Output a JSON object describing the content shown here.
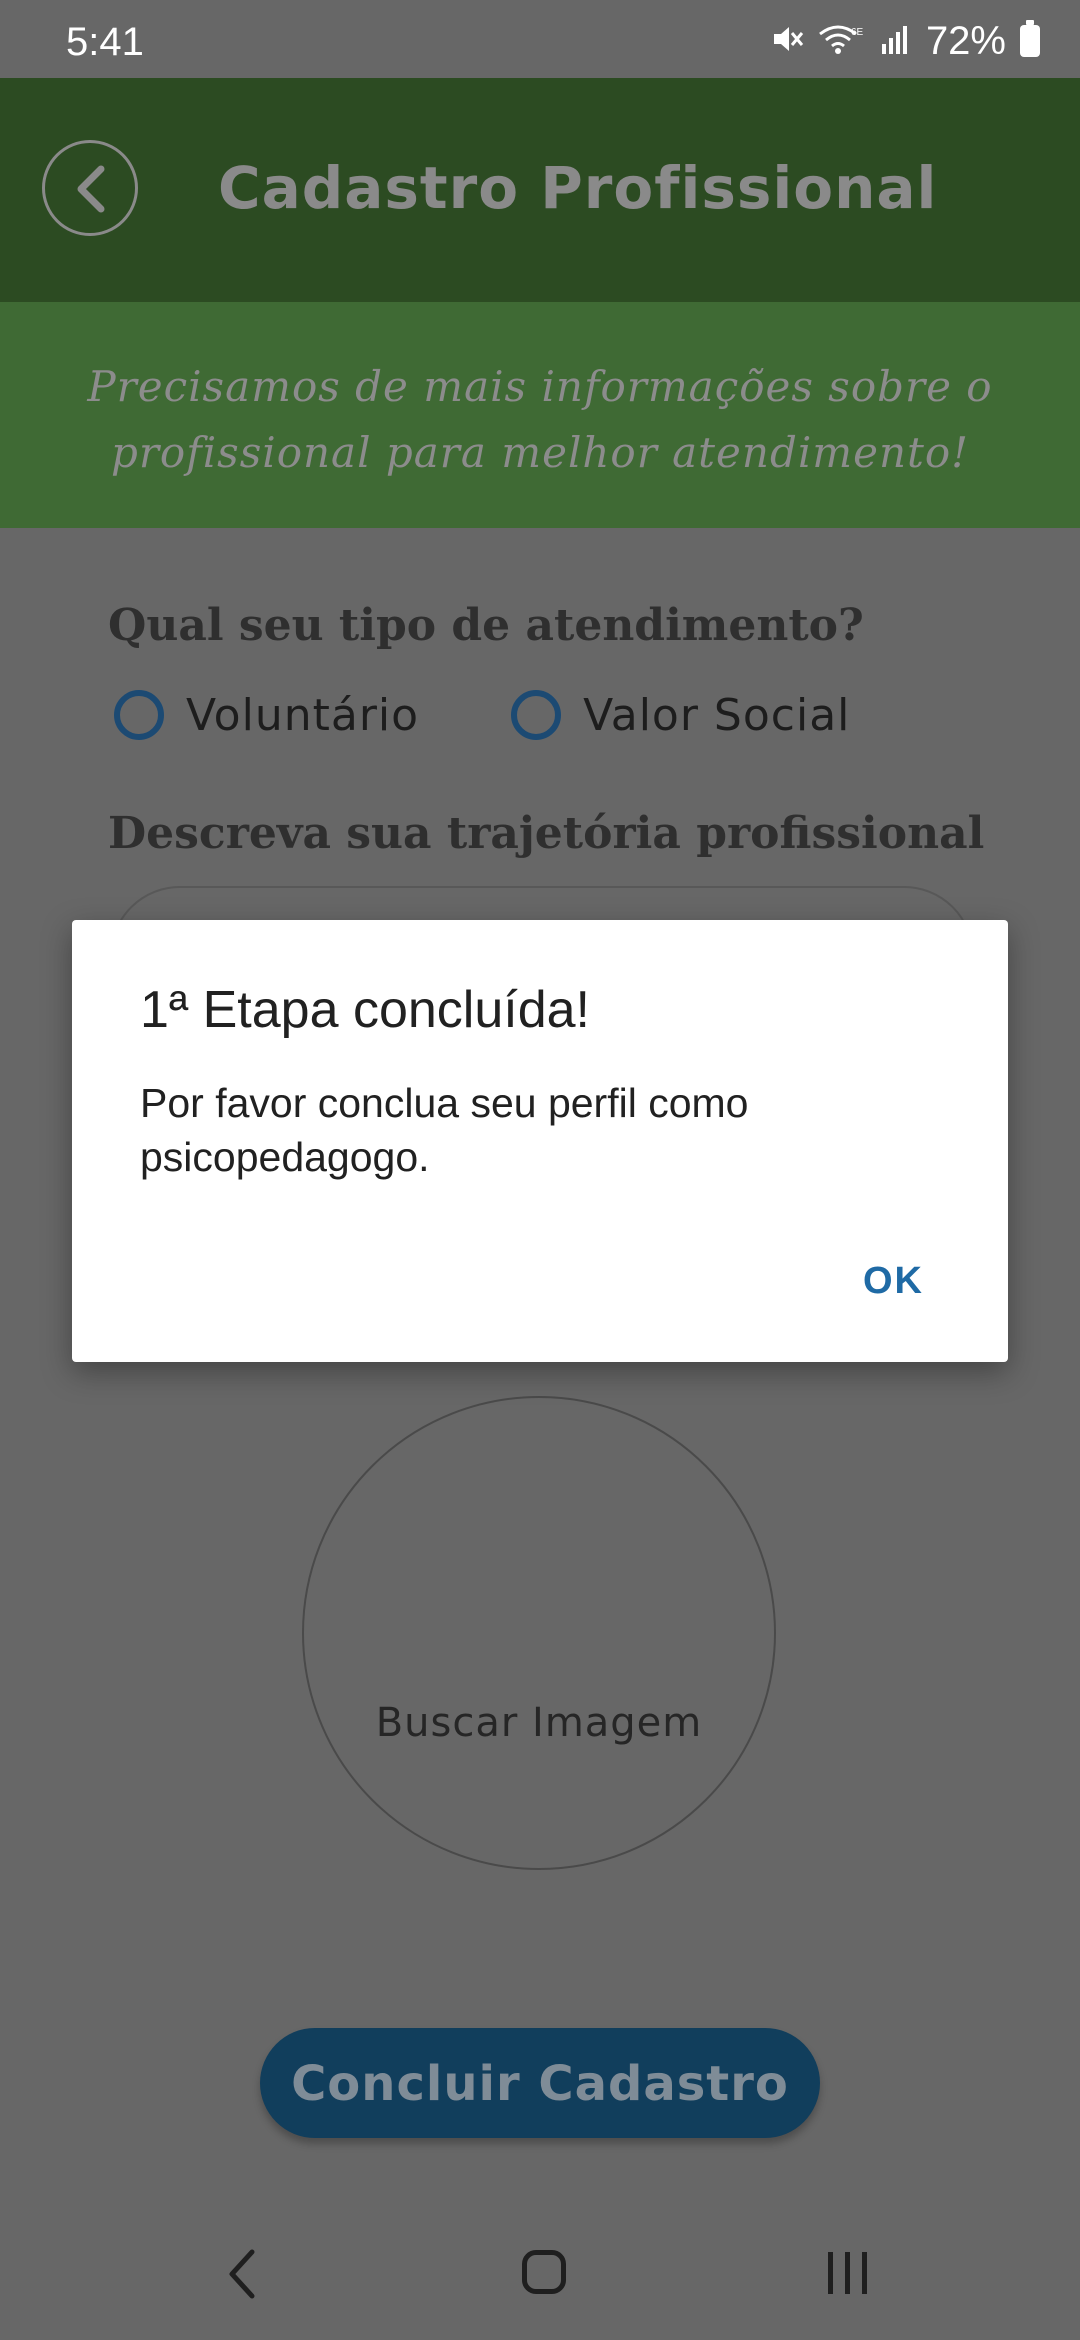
{
  "status_bar": {
    "time": "5:41",
    "battery": "72%",
    "icons": [
      "mute-icon",
      "wifi-6e-icon",
      "signal-icon",
      "battery-icon"
    ]
  },
  "header": {
    "title": "Cadastro Profissional",
    "back_icon": "chevron-left-icon"
  },
  "subheader": {
    "text": "Precisamos de mais informações sobre o profissional para melhor atendimento!"
  },
  "form": {
    "attendance_label": "Qual seu tipo de atendimento?",
    "options": [
      "Voluntário",
      "Valor Social"
    ],
    "trajectory_label": "Descreva sua trajetória profissional",
    "image_picker_label": "Buscar Imagem",
    "submit_label": "Concluir Cadastro"
  },
  "dialog": {
    "title": "1ª Etapa concluída!",
    "message": "Por favor conclua seu perfil como psicopedagogo.",
    "ok_label": "OK"
  },
  "colors": {
    "header_bg": "#2c4b22",
    "subheader_bg": "#3f6a34",
    "accent_blue": "#1f6aa5",
    "submit_bg": "#113e5c"
  }
}
